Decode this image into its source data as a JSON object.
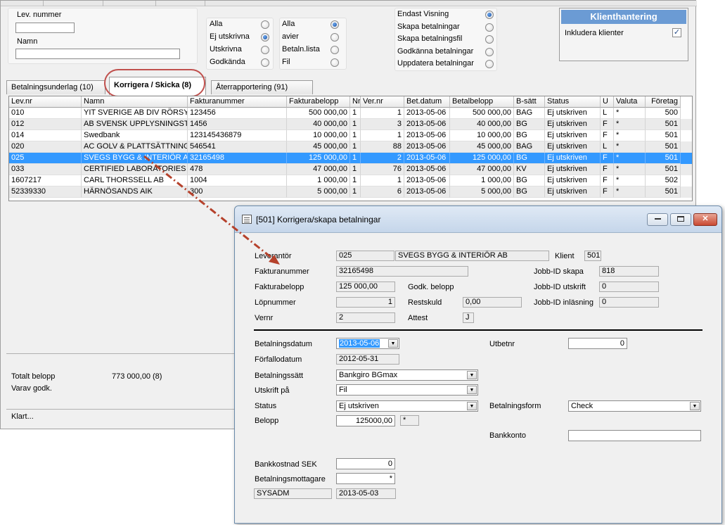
{
  "filters": {
    "lev_nummer_label": "Lev. nummer",
    "lev_nummer_value": "",
    "namn_label": "Namn",
    "namn_value": "",
    "group1": [
      {
        "label": "Alla",
        "selected": false
      },
      {
        "label": "Ej utskrivna",
        "selected": true
      },
      {
        "label": "Utskrivna",
        "selected": false
      },
      {
        "label": "Godkända",
        "selected": false
      }
    ],
    "group2": [
      {
        "label": "Alla",
        "selected": true
      },
      {
        "label": "avier",
        "selected": false
      },
      {
        "label": "Betaln.lista",
        "selected": false
      },
      {
        "label": "Fil",
        "selected": false
      }
    ],
    "group3": [
      {
        "label": "Endast Visning",
        "selected": true
      },
      {
        "label": "Skapa betalningar",
        "selected": false
      },
      {
        "label": "Skapa betalningsfil",
        "selected": false
      },
      {
        "label": "Godkänna betalningar",
        "selected": false
      },
      {
        "label": "Uppdatera betalningar",
        "selected": false
      }
    ]
  },
  "klient": {
    "title": "Klienthantering",
    "checkbox_label": "Inkludera klienter",
    "checked": true
  },
  "tabs": [
    {
      "label": "Betalningsunderlag (10)",
      "active": false
    },
    {
      "label": "Korrigera / Skicka (8)",
      "active": true
    },
    {
      "label": "Återrapportering (91)",
      "active": false
    }
  ],
  "table": {
    "columns": [
      "Lev.nr",
      "Namn",
      "Fakturanummer",
      "Fakturabelopp",
      "Nr",
      "Ver.nr",
      "Bet.datum",
      "Betalbelopp",
      "B-sätt",
      "Status",
      "U",
      "Valuta",
      "Företag"
    ],
    "rows": [
      [
        "010",
        "YIT SVERIGE AB DIV RÖRSYSTEM",
        "123456",
        "500 000,00",
        "1",
        "1",
        "2013-05-06",
        "500 000,00",
        "BAG",
        "Ej utskriven",
        "L",
        "*",
        "500"
      ],
      [
        "012",
        "AB SVENSK UPPLYSNINGSTJÄNST",
        "1456",
        "40 000,00",
        "1",
        "3",
        "2013-05-06",
        "40 000,00",
        "BG",
        "Ej utskriven",
        "F",
        "*",
        "501"
      ],
      [
        "014",
        "Swedbank",
        "123145436879",
        "10 000,00",
        "1",
        "1",
        "2013-05-06",
        "10 000,00",
        "BG",
        "Ej utskriven",
        "F",
        "*",
        "501"
      ],
      [
        "020",
        "AC GOLV & PLATTSÄTTNING",
        "546541",
        "45 000,00",
        "1",
        "88",
        "2013-05-06",
        "45 000,00",
        "BAG",
        "Ej utskriven",
        "L",
        "*",
        "501"
      ],
      [
        "025",
        "SVEGS BYGG & INTERIÖR AB",
        "32165498",
        "125 000,00",
        "1",
        "2",
        "2013-05-06",
        "125 000,00",
        "BG",
        "Ej utskriven",
        "F",
        "*",
        "501"
      ],
      [
        "033",
        "CERTIFIED LABORATORIES",
        "478",
        "47 000,00",
        "1",
        "76",
        "2013-05-06",
        "47 000,00",
        "KV",
        "Ej utskriven",
        "F",
        "*",
        "501"
      ],
      [
        "1607217",
        "CARL THORSSELL AB",
        "1004",
        "1 000,00",
        "1",
        "1",
        "2013-05-06",
        "1 000,00",
        "BG",
        "Ej utskriven",
        "F",
        "*",
        "502"
      ],
      [
        "52339330",
        "HÄRNÖSANDS AIK",
        "300",
        "5 000,00",
        "1",
        "6",
        "2013-05-06",
        "5 000,00",
        "BG",
        "Ej utskriven",
        "F",
        "*",
        "501"
      ]
    ],
    "selected_row": 4
  },
  "summary": {
    "totalt_label": "Totalt belopp",
    "totalt_value": "773 000,00",
    "totalt_count": "(8)",
    "varav_label": "Varav godk."
  },
  "statusbar": "Klart...",
  "dialog": {
    "title": "[501]  Korrigera/skapa betalningar",
    "leverantor_label": "Leverantör",
    "leverantor_nr": "025",
    "leverantor_namn": "SVEGS BYGG & INTERIÖR AB",
    "klient_label": "Klient",
    "klient_value": "501",
    "fakturanummer_label": "Fakturanummer",
    "fakturanummer_value": "32165498",
    "jobb_skapa_label": "Jobb-ID skapa",
    "jobb_skapa_value": "818",
    "fakturabelopp_label": "Fakturabelopp",
    "fakturabelopp_value": "125 000,00",
    "godk_belopp_label": "Godk. belopp",
    "jobb_utskrift_label": "Jobb-ID utskrift",
    "jobb_utskrift_value": "0",
    "lopnummer_label": "Löpnummer",
    "lopnummer_value": "1",
    "restskuld_label": "Restskuld",
    "restskuld_value": "0,00",
    "jobb_inlasning_label": "Jobb-ID inläsning",
    "jobb_inlasning_value": "0",
    "vernr_label": "Vernr",
    "vernr_value": "2",
    "attest_label": "Attest",
    "attest_value": "J",
    "betalningsdatum_label": "Betalningsdatum",
    "betalningsdatum_value": "2013-05-06",
    "utbetnr_label": "Utbetnr",
    "utbetnr_value": "0",
    "forfallodatum_label": "Förfallodatum",
    "forfallodatum_value": "2012-05-31",
    "betalningssatt_label": "Betalningssätt",
    "betalningssatt_value": "Bankgiro BGmax",
    "utskrift_label": "Utskrift på",
    "utskrift_value": "Fil",
    "status_label": "Status",
    "status_value": "Ej utskriven",
    "betalningsform_label": "Betalningsform",
    "betalningsform_value": "Check",
    "belopp_label": "Belopp",
    "belopp_value": "125000,00",
    "belopp_currency": "*",
    "bankkonto_label": "Bankkonto",
    "bankkonto_value": "",
    "bankkostnad_label": "Bankkostnad SEK",
    "bankkostnad_value": "0",
    "mottagare_label": "Betalningsmottagare",
    "mottagare_value": "*",
    "user_value": "SYSADM",
    "user_date": "2013-05-03"
  },
  "colors": {
    "selection": "#3399ff",
    "klient_header": "#6b9bd4",
    "annotation": "#b5412b"
  }
}
